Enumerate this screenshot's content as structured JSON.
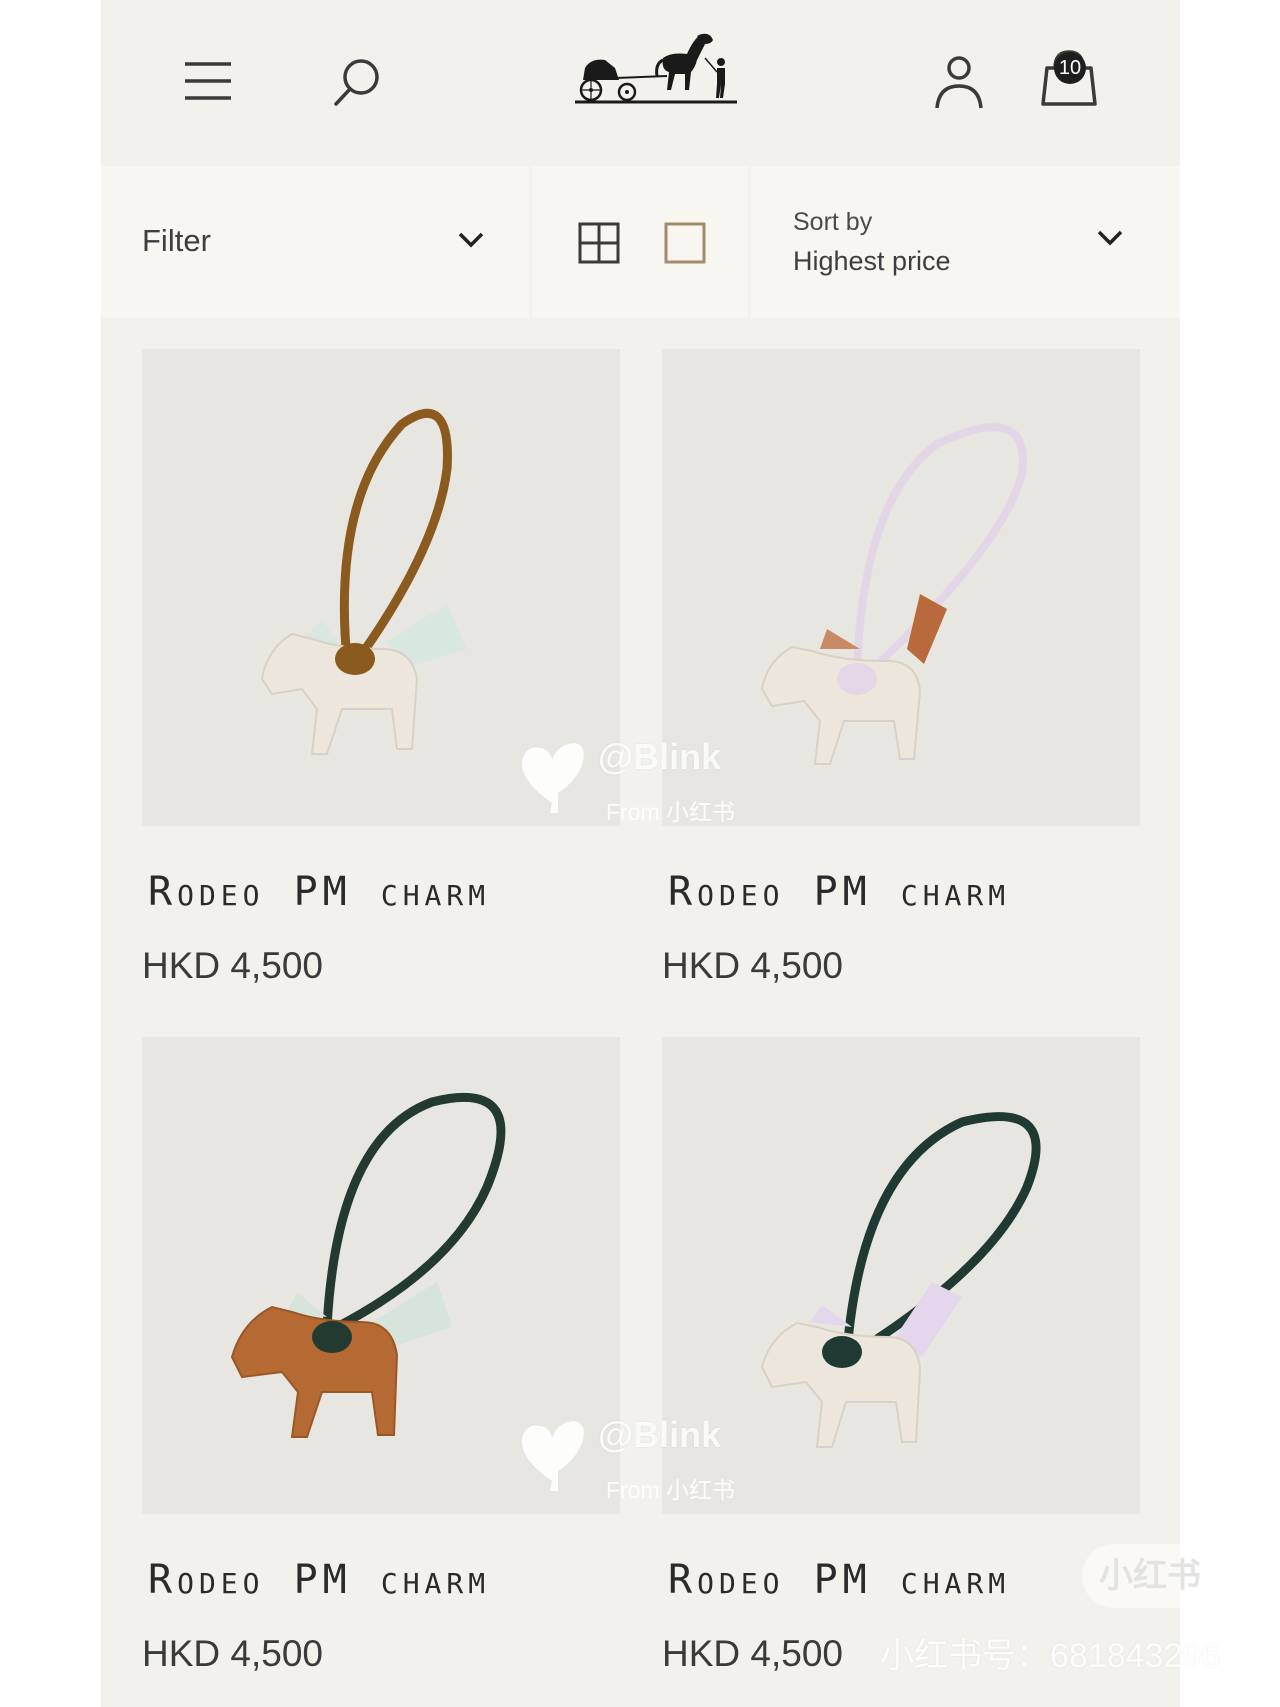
{
  "header": {
    "bag_count": "10"
  },
  "toolbar": {
    "filter_label": "Filter",
    "sort_caption": "Sort by",
    "sort_value": "Highest price"
  },
  "products": [
    {
      "name": "Rodeo PM charm",
      "price": "HKD 4,500"
    },
    {
      "name": "Rodeo PM charm",
      "price": "HKD 4,500"
    },
    {
      "name": "Rodeo PM charm",
      "price": "HKD 4,500"
    },
    {
      "name": "Rodeo PM charm",
      "price": "HKD 4,500"
    }
  ],
  "watermark": {
    "handle": "@Blink",
    "source": "From 小红书",
    "badge": "小红书",
    "account_id": "小红书号：681843296"
  },
  "colors": {
    "page_background": "#f3f1ec",
    "toolbar_background": "#f8f6f1",
    "image_background": "#e8e6e1"
  }
}
